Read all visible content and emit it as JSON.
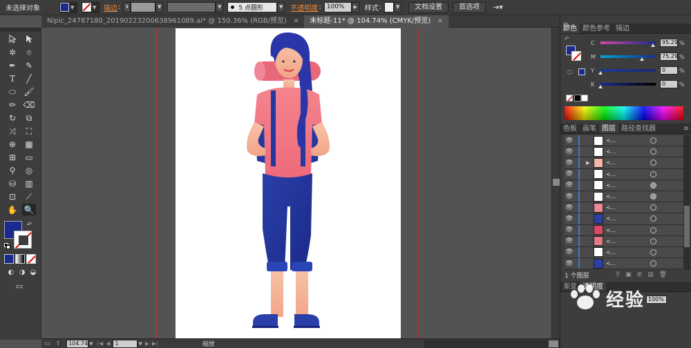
{
  "control_bar": {
    "selection_label": "未选择对象",
    "fill_color": "#1a2a8f",
    "stroke_label": "描边",
    "brush_value": "5 点圆形",
    "opacity_label": "不透明度",
    "opacity_value": "100%",
    "style_label": "样式",
    "doc_settings_label": "文档设置",
    "preferences_label": "首选项"
  },
  "tabs": [
    {
      "label": "Nipic_24787180_20190223200638961089.ai* @ 150.36% (RGB/预览)",
      "active": false
    },
    {
      "label": "未标题-11* @ 104.74% (CMYK/预览)",
      "active": true
    }
  ],
  "tools": {
    "fill_color": "#1a2a8f"
  },
  "status_bar": {
    "zoom": "104.74",
    "artboard": "1",
    "tool_label": "缩放"
  },
  "color_panel": {
    "tabs": [
      "颜色",
      "颜色参考",
      "描边"
    ],
    "channels": [
      {
        "label": "C",
        "value": "95.29",
        "fraction": 0.95
      },
      {
        "label": "M",
        "value": "75.29",
        "fraction": 0.75
      },
      {
        "label": "Y",
        "value": "0",
        "fraction": 0.0
      },
      {
        "label": "K",
        "value": "0",
        "fraction": 0.0
      }
    ],
    "unit": "%",
    "fill_color": "#1a2a8f"
  },
  "layers_panel": {
    "tabs": [
      "色板",
      "画笔",
      "图层",
      "路径查找器"
    ],
    "rows": [
      {
        "name": "<...",
        "expandable": false,
        "thumb_color": "#ffffff",
        "target_filled": false
      },
      {
        "name": "<...",
        "expandable": false,
        "thumb_color": "#ffffff",
        "target_filled": false
      },
      {
        "name": "<...",
        "expandable": true,
        "thumb_color": "#f4b8a8",
        "target_filled": false
      },
      {
        "name": "<...",
        "expandable": false,
        "thumb_color": "#ffffff",
        "target_filled": false
      },
      {
        "name": "<...",
        "expandable": false,
        "thumb_color": "#ffffff",
        "target_filled": true
      },
      {
        "name": "<...",
        "expandable": false,
        "thumb_color": "#ffffff",
        "target_filled": true
      },
      {
        "name": "<...",
        "expandable": false,
        "thumb_color": "#ee8a96",
        "target_filled": false
      },
      {
        "name": "<...",
        "expandable": false,
        "thumb_color": "#2a3fa8",
        "target_filled": false
      },
      {
        "name": "<...",
        "expandable": false,
        "thumb_color": "#d94a6a",
        "target_filled": false
      },
      {
        "name": "<...",
        "expandable": false,
        "thumb_color": "#e37a88",
        "target_filled": false
      },
      {
        "name": "<...",
        "expandable": false,
        "thumb_color": "#ffffff",
        "target_filled": false
      },
      {
        "name": "<...",
        "expandable": false,
        "thumb_color": "#2a3fa8",
        "target_filled": false
      }
    ],
    "footer": "1 个图层"
  },
  "bottom_panel": {
    "tabs": [
      "渐变",
      "透明度"
    ],
    "value": "100%"
  },
  "watermark": "经验"
}
